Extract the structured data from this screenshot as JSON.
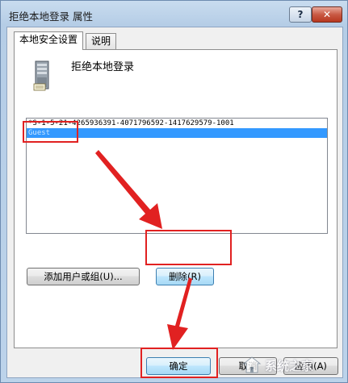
{
  "window": {
    "title": "拒绝本地登录 属性",
    "help_label": "?",
    "close_label": "✕"
  },
  "tabs": [
    {
      "label": "本地安全设置",
      "active": true
    },
    {
      "label": "说明",
      "active": false
    }
  ],
  "panel": {
    "heading": "拒绝本地登录",
    "icon": "server-icon"
  },
  "list": {
    "items": [
      {
        "text": "*S-1-5-21-4265936391-4071796592-1417629579-1001",
        "selected": false
      },
      {
        "text": "Guest",
        "selected": true
      }
    ]
  },
  "buttons": {
    "add_label": "添加用户或组(U)...",
    "remove_label": "删除(R)",
    "ok_label": "确定",
    "cancel_label": "取消",
    "apply_label": "应用(A)"
  },
  "annotations": {
    "color": "#e12121"
  },
  "watermark": {
    "text": "系统之家"
  },
  "colors": {
    "selection": "#3399ff",
    "annotation": "#e12121"
  }
}
